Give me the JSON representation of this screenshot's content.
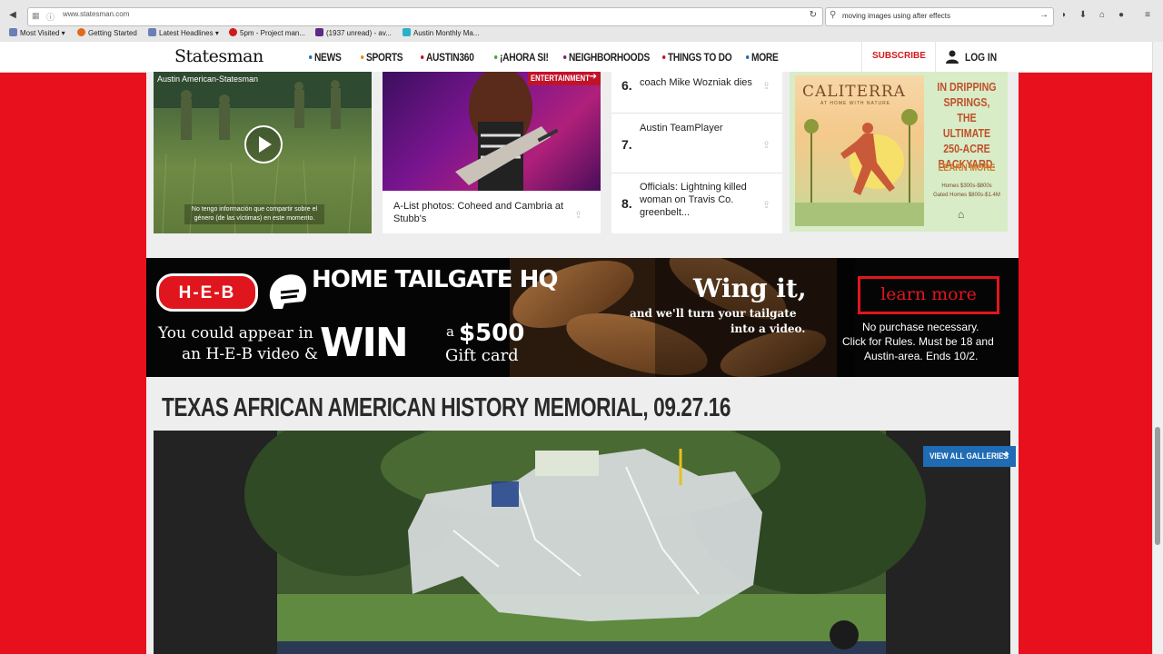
{
  "browser": {
    "url": "www.statesman.com",
    "search_value": "moving images using after effects",
    "bookmarks": [
      "Most Visited",
      "Getting Started",
      "Latest Headlines",
      "5pm - Project man...",
      "(1937 unread) - av...",
      "Austin Monthly Ma..."
    ],
    "icons": [
      "back-icon",
      "reload-icon",
      "pocket-icon",
      "download-icon",
      "home-icon",
      "menu-icon"
    ]
  },
  "site": {
    "logo": "Statesman",
    "nav": [
      {
        "label": "NEWS",
        "color": "#1f6cb5"
      },
      {
        "label": "SPORTS",
        "color": "#e88a1a"
      },
      {
        "label": "AUSTIN360",
        "color": "#c0132a"
      },
      {
        "label": "¡AHORA SI!",
        "color": "#4aa832"
      },
      {
        "label": "NEIGHBORHOODS",
        "color": "#7a1f7a"
      },
      {
        "label": "THINGS TO DO",
        "color": "#c0132a"
      },
      {
        "label": "MORE",
        "color": "#1f6cb5"
      }
    ],
    "subscribe": "SUBSCRIBE",
    "login": "LOG IN"
  },
  "cards": {
    "video": {
      "source": "Austin American-Statesman",
      "subtitle": "No tengo información que compartir sobre el género (de las víctimas) en este momento."
    },
    "entertainment": {
      "tag": "ENTERTAINMENT",
      "caption": "A-List photos: Coheed and Cambria at Stubb's"
    },
    "most_read": [
      {
        "rank": "6.",
        "title": "coach Mike Wozniak dies"
      },
      {
        "rank": "7.",
        "title": "Austin TeamPlayer"
      },
      {
        "rank": "8.",
        "title": "Officials: Lightning killed woman on Travis Co. greenbelt..."
      }
    ],
    "caliterra_ad": {
      "brand": "CALITERRA",
      "tagline": "AT HOME WITH NATURE",
      "headline": [
        "IN DRIPPING",
        "SPRINGS,",
        "THE ULTIMATE",
        "250-ACRE",
        "BACKYARD."
      ],
      "cta": "LEARN MORE",
      "prices": [
        "Homes $300s-$800s",
        "Gated Homes $800s-$1.4M"
      ]
    }
  },
  "heb_ad": {
    "logo": "H-E-B",
    "headline": "HOME TAILGATE HQ",
    "line1": "You could appear in",
    "line2": "an H-E-B video &",
    "win": "WIN",
    "prize_a": "a",
    "prize_amount": "$500",
    "prize_card": "Gift card",
    "wing": "Wing it,",
    "wing_sub1": "and we'll turn your tailgate",
    "wing_sub2": "into a video.",
    "cta": "learn more",
    "fine1": "No purchase necessary.",
    "fine2": "Click for Rules. Must be 18 and",
    "fine3": "Austin-area. Ends 10/2."
  },
  "gallery": {
    "title": "TEXAS AFRICAN AMERICAN HISTORY MEMORIAL, 09.27.16",
    "view_all": "VIEW ALL GALLERIES"
  }
}
